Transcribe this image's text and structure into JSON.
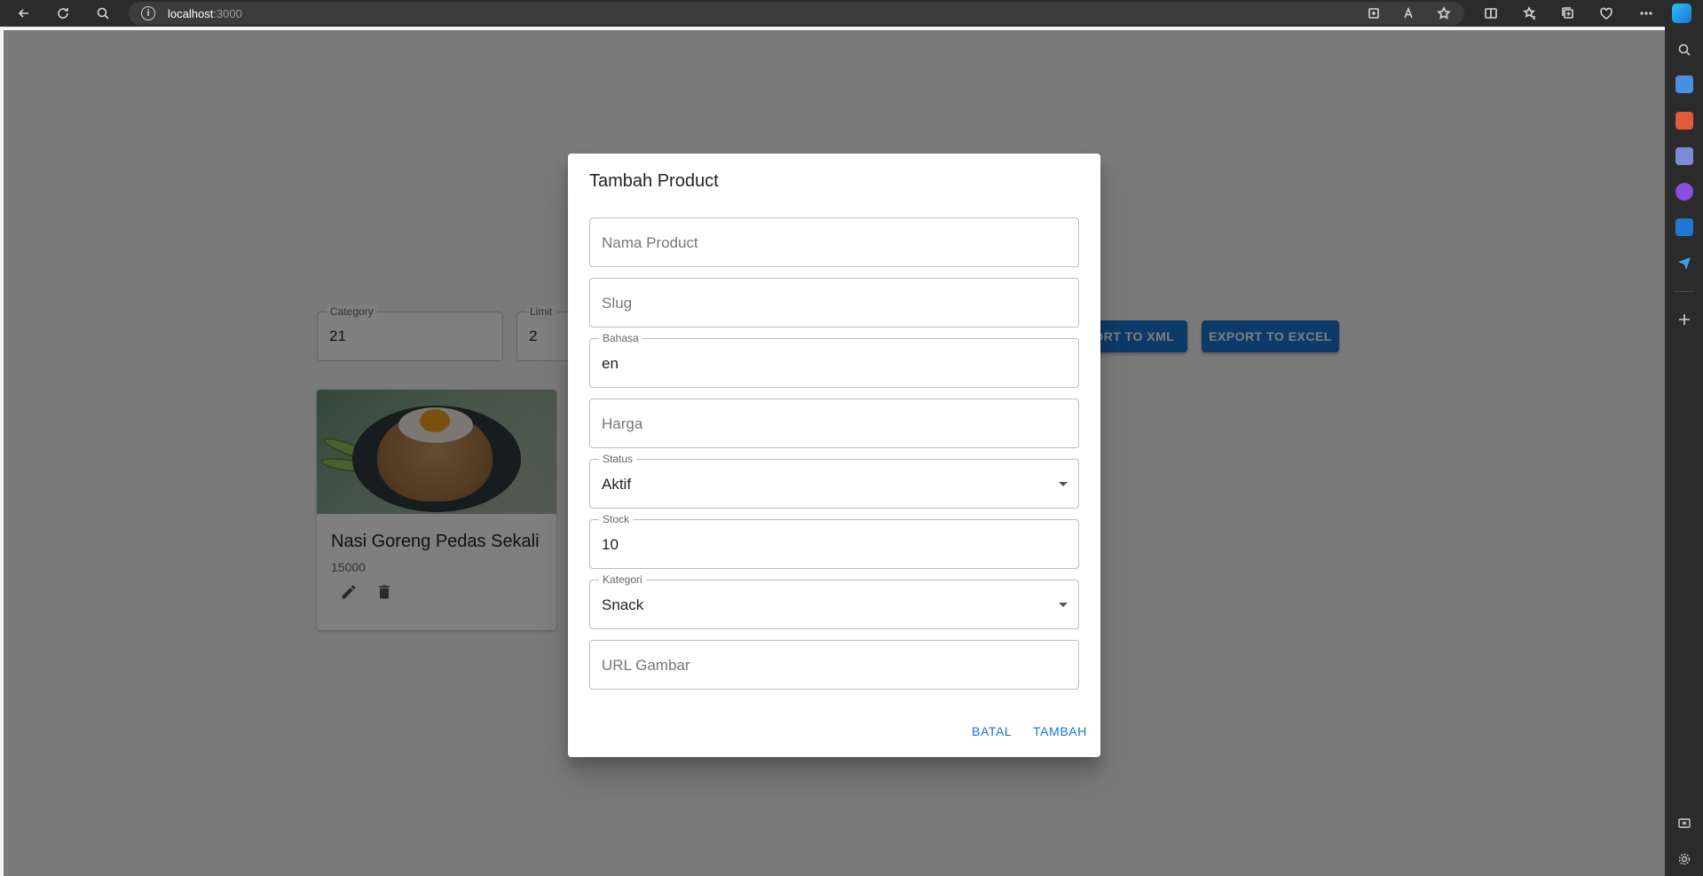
{
  "browser": {
    "url_host": "localhost",
    "url_port": ":3000"
  },
  "page": {
    "category": {
      "label": "Category",
      "value": "21"
    },
    "limit": {
      "label": "Limit",
      "value": "2"
    },
    "export_xml_label": "EXPORT TO XML",
    "export_excel_label": "EXPORT TO EXCEL",
    "card": {
      "title": "Nasi Goreng Pedas Sekali",
      "price": "15000"
    }
  },
  "dialog": {
    "title": "Tambah Product",
    "fields": {
      "nama_product": {
        "placeholder": "Nama Product"
      },
      "slug": {
        "placeholder": "Slug"
      },
      "bahasa": {
        "label": "Bahasa",
        "value": "en"
      },
      "harga": {
        "placeholder": "Harga"
      },
      "status": {
        "label": "Status",
        "value": "Aktif"
      },
      "stock": {
        "label": "Stock",
        "value": "10"
      },
      "kategori": {
        "label": "Kategori",
        "value": "Snack"
      },
      "url_gambar": {
        "placeholder": "URL Gambar"
      }
    },
    "cancel_label": "BATAL",
    "submit_label": "TAMBAH"
  },
  "colors": {
    "primary": "#1976d2",
    "overlay": "rgba(0,0,0,0.5)"
  },
  "icons": {
    "edit": "pencil-icon",
    "delete": "trash-icon"
  }
}
